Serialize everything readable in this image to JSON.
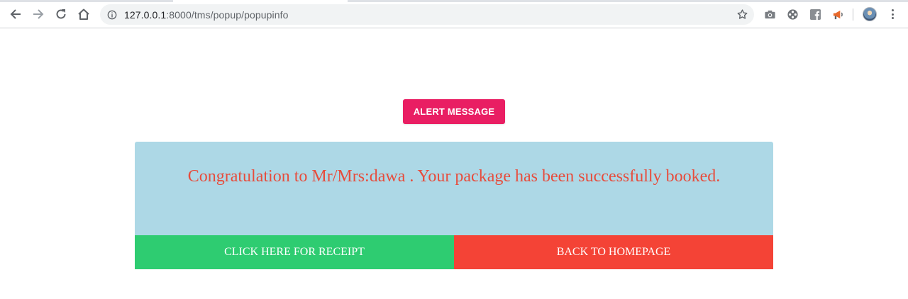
{
  "browser": {
    "url_host": "127.0.0.1",
    "url_path": ":8000/tms/popup/popupinfo",
    "extensions": [
      "camera-icon",
      "film-reel-icon",
      "facebook-icon",
      "megaphone-icon"
    ]
  },
  "page": {
    "alert_button_label": "ALERT MESSAGE",
    "message": "Congratulation to Mr/Mrs:dawa . Your package has been successfully booked.",
    "receipt_button_label": "CLICK HERE FOR RECEIPT",
    "home_button_label": "BACK TO HOMEPAGE"
  },
  "colors": {
    "alert_button": "#e91e63",
    "panel_background": "#add8e6",
    "message_text": "#e74c3c",
    "receipt_button": "#2ecc71",
    "home_button": "#f44336"
  }
}
